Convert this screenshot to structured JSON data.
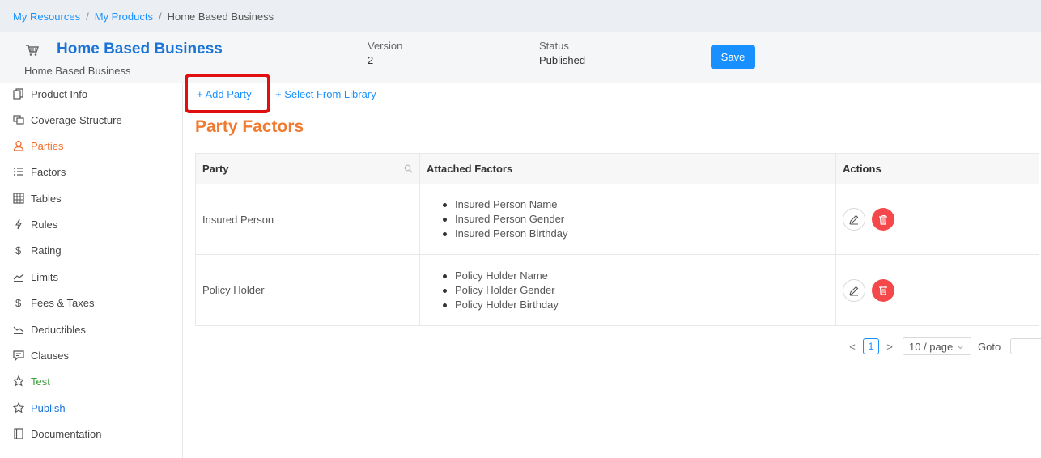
{
  "breadcrumb": {
    "items": [
      "My Resources",
      "My Products",
      "Home Based Business"
    ],
    "separator": "/"
  },
  "header": {
    "title": "Home Based Business",
    "subtitle": "Home Based Business",
    "version_label": "Version",
    "version_value": "2",
    "status_label": "Status",
    "status_value": "Published",
    "save_label": "Save"
  },
  "sidebar": {
    "items": [
      {
        "label": "Product Info",
        "icon": "copy-icon"
      },
      {
        "label": "Coverage Structure",
        "icon": "layers-icon"
      },
      {
        "label": "Parties",
        "icon": "user-icon",
        "active": true
      },
      {
        "label": "Factors",
        "icon": "list-icon"
      },
      {
        "label": "Tables",
        "icon": "grid-icon"
      },
      {
        "label": "Rules",
        "icon": "bolt-icon"
      },
      {
        "label": "Rating",
        "icon": "dollar-icon"
      },
      {
        "label": "Limits",
        "icon": "trend-icon"
      },
      {
        "label": "Fees & Taxes",
        "icon": "dollar-icon"
      },
      {
        "label": "Deductibles",
        "icon": "trend-down-icon"
      },
      {
        "label": "Clauses",
        "icon": "comment-icon"
      },
      {
        "label": "Test",
        "icon": "star-icon"
      },
      {
        "label": "Publish",
        "icon": "star-icon"
      },
      {
        "label": "Documentation",
        "icon": "book-icon"
      }
    ]
  },
  "actions": {
    "add_party": "+ Add Party",
    "select_library": "+ Select From Library"
  },
  "section_title": "Party Factors",
  "table": {
    "headers": [
      "Party",
      "Attached Factors",
      "Actions"
    ],
    "rows": [
      {
        "party": "Insured Person",
        "factors": [
          "Insured Person Name",
          "Insured Person Gender",
          "Insured Person Birthday"
        ]
      },
      {
        "party": "Policy Holder",
        "factors": [
          "Policy Holder Name",
          "Policy Holder Gender",
          "Policy Holder Birthday"
        ]
      }
    ]
  },
  "pagination": {
    "current_page": "1",
    "page_size": "10 / page",
    "goto_label": "Goto",
    "prev": "<",
    "next": ">"
  },
  "colors": {
    "primary": "#1890ff",
    "accent_orange": "#f07a30",
    "delete_red": "#f5484b",
    "highlight_red": "#e01010",
    "test_green": "#3a9d3a"
  }
}
